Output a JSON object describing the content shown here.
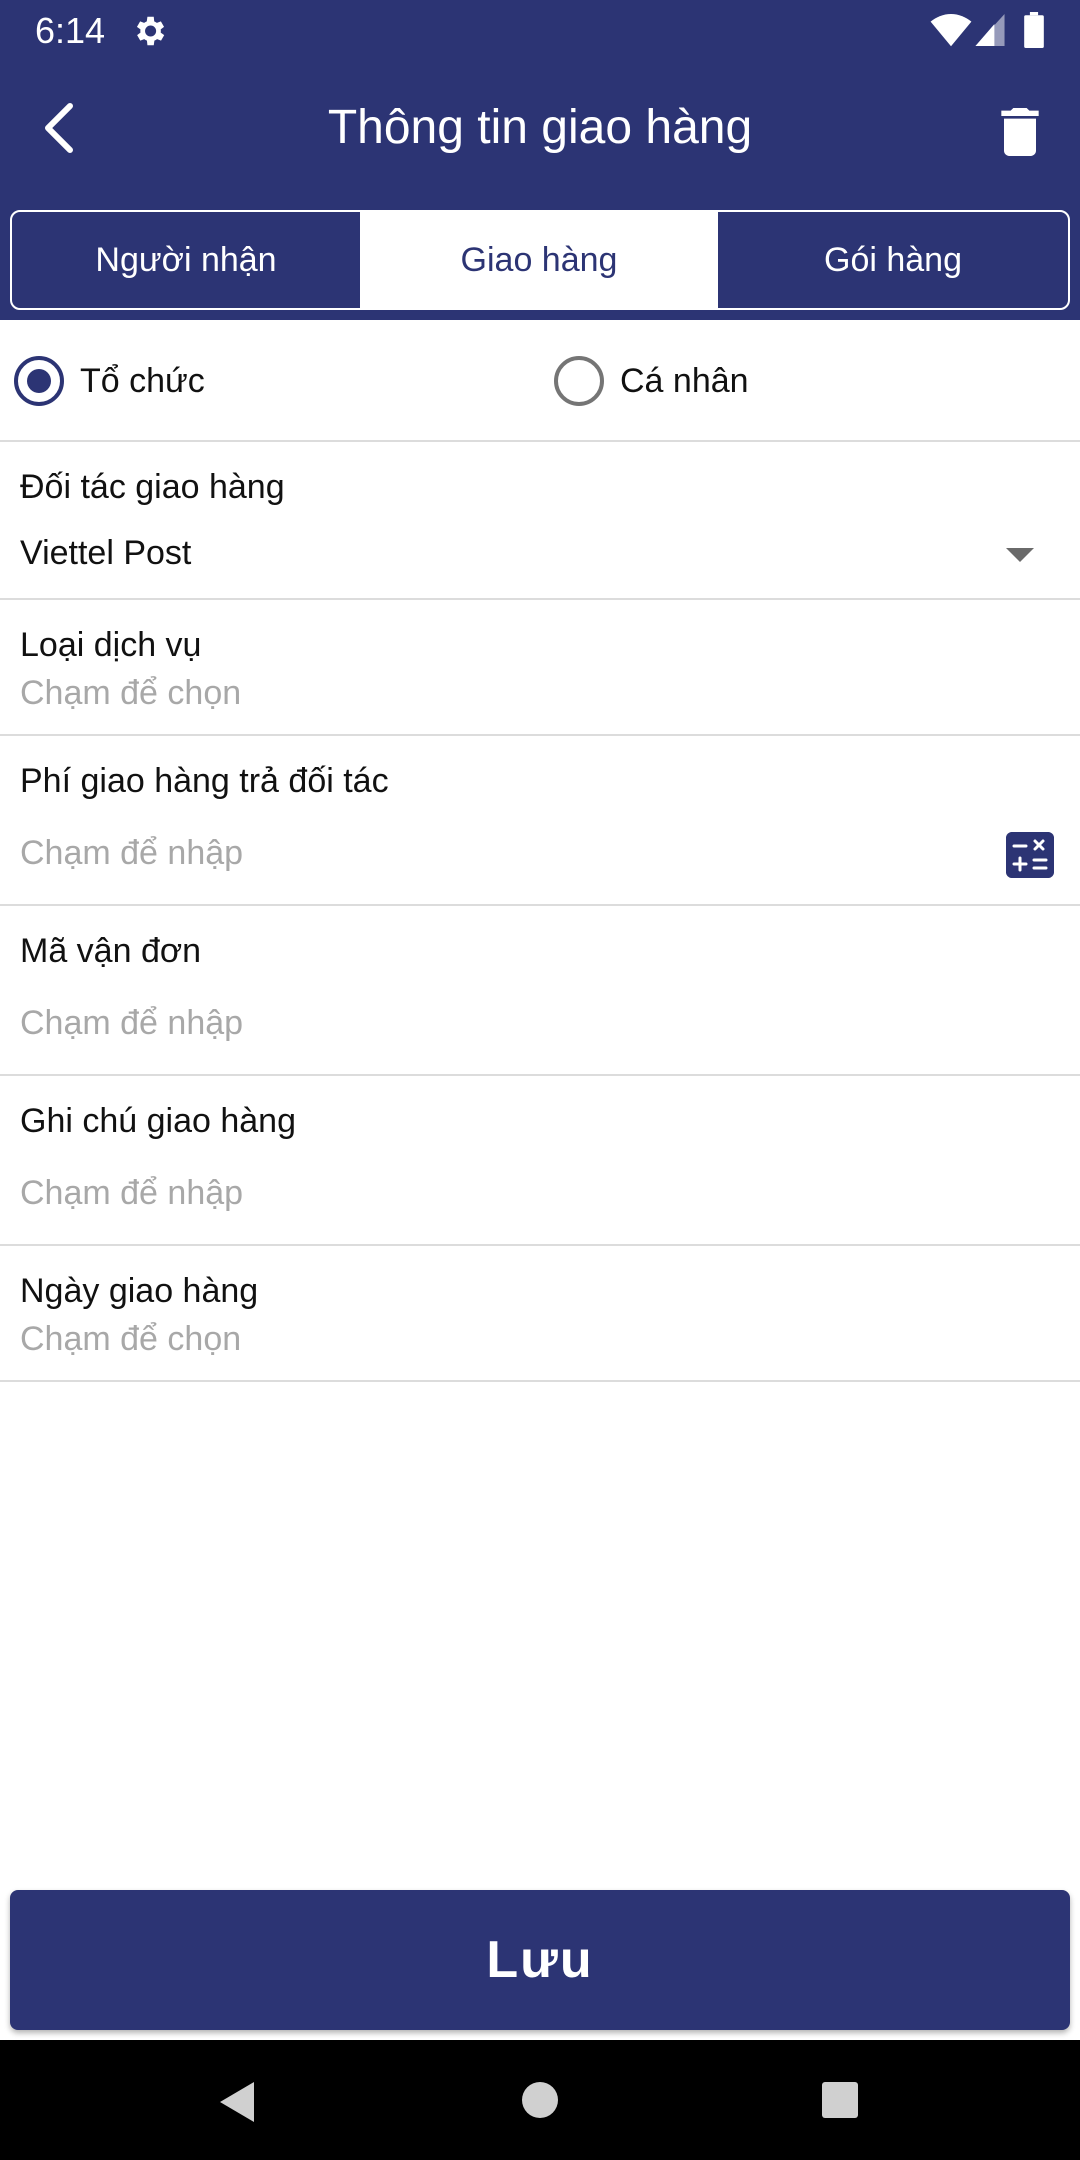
{
  "status_bar": {
    "time": "6:14",
    "icons": [
      "gear-icon",
      "wifi-icon",
      "signal-icon",
      "battery-icon"
    ]
  },
  "app_bar": {
    "title": "Thông tin giao hàng",
    "back_icon": "chevron-left-icon",
    "delete_icon": "trash-icon"
  },
  "tabs": [
    {
      "label": "Người nhận",
      "selected": false
    },
    {
      "label": "Giao hàng",
      "selected": true
    },
    {
      "label": "Gói hàng",
      "selected": false
    }
  ],
  "recipient_type": {
    "options": [
      {
        "label": "Tổ chức",
        "checked": true
      },
      {
        "label": "Cá nhân",
        "checked": false
      }
    ]
  },
  "form": {
    "partner": {
      "label": "Đối tác giao hàng",
      "value": "Viettel Post"
    },
    "service_type": {
      "label": "Loại dịch vụ",
      "placeholder": "Chạm để chọn"
    },
    "shipping_fee": {
      "label": "Phí giao hàng trả đối tác",
      "placeholder": "Chạm để nhập"
    },
    "tracking_code": {
      "label": "Mã vận đơn",
      "placeholder": "Chạm để nhập"
    },
    "delivery_note": {
      "label": "Ghi chú giao hàng",
      "placeholder": "Chạm để nhập"
    },
    "delivery_date": {
      "label": "Ngày giao hàng",
      "placeholder": "Chạm để chọn"
    }
  },
  "save_button": {
    "label": "Lưu"
  },
  "colors": {
    "primary": "#2c3474",
    "divider": "#dcdcdc",
    "placeholder": "#a8a8a8"
  }
}
